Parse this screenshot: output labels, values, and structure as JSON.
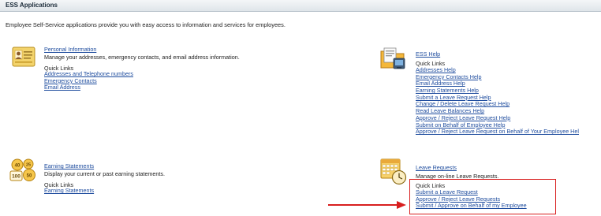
{
  "header": {
    "title": "ESS Applications"
  },
  "intro": {
    "text": "Employee Self-Service applications provide you with easy access to information and services for employees."
  },
  "personal_info": {
    "title": "Personal Information",
    "description": "Manage your addresses, emergency contacts, and email address information.",
    "quick_links_label": "Quick Links",
    "links": [
      "Addresses and Telephone numbers",
      "Emergency Contacts",
      "Email Address"
    ]
  },
  "ess_help": {
    "title": "ESS Help",
    "quick_links_label": "Quick Links",
    "links": [
      "Addresses Help",
      "Emergency Contacts Help",
      "Email Address Help",
      "Earning Statements Help",
      "Submit a Leave Request Help",
      "Change / Delete Leave Request Help",
      "Read Leave Balances Help",
      "Approve / Reject Leave Request Help",
      "Submit on Behalf of Employee Help",
      "Approve / Reject Leave Request on Behalf of Your Employee Hel"
    ]
  },
  "earning_statements": {
    "title": "Earning Statements",
    "description": "Display your current or past earning statements.",
    "quick_links_label": "Quick Links",
    "links": [
      "Earning Statements"
    ],
    "icon_numbers": [
      "40",
      "25",
      "100",
      "50"
    ]
  },
  "leave_requests": {
    "title": "Leave Requests",
    "description": "Manage on-line Leave Requests.",
    "quick_links_label": "Quick Links",
    "links": [
      "Submit a Leave Request",
      "Approve / Reject Leave Requests",
      "Submit / Approve on Behalf of my Employee"
    ]
  },
  "annotation": {
    "highlight_color": "#d81e1e"
  }
}
